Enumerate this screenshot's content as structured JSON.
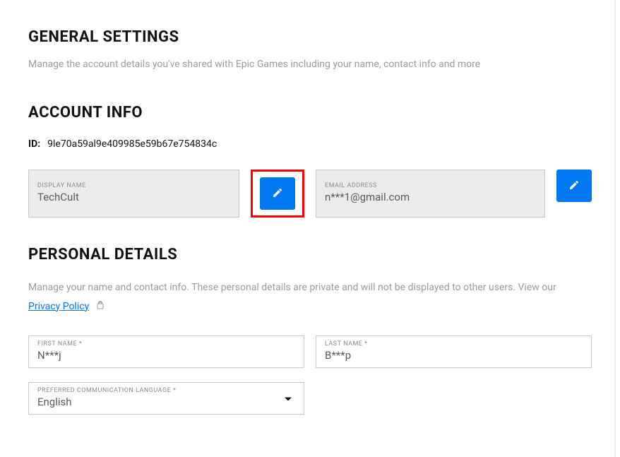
{
  "general": {
    "title": "GENERAL SETTINGS",
    "subtitle": "Manage the account details you've shared with Epic Games including your name, contact info and more"
  },
  "account": {
    "title": "ACCOUNT INFO",
    "id_label": "ID:",
    "id_value": "9le70a59al9e409985e59b67e754834c",
    "display_name_label": "DISPLAY NAME",
    "display_name_value": "TechCult",
    "email_label": "EMAIL ADDRESS",
    "email_value": "n***1@gmail.com"
  },
  "personal": {
    "title": "PERSONAL DETAILS",
    "subtitle": "Manage your name and contact info. These personal details are private and will not be displayed to other users. View our",
    "privacy_link": "Privacy Policy",
    "first_name_label": "FIRST NAME *",
    "first_name_value": "N***j",
    "last_name_label": "LAST NAME *",
    "last_name_value": "B***p",
    "language_label": "PREFERRED COMMUNICATION LANGUAGE *",
    "language_value": "English"
  }
}
